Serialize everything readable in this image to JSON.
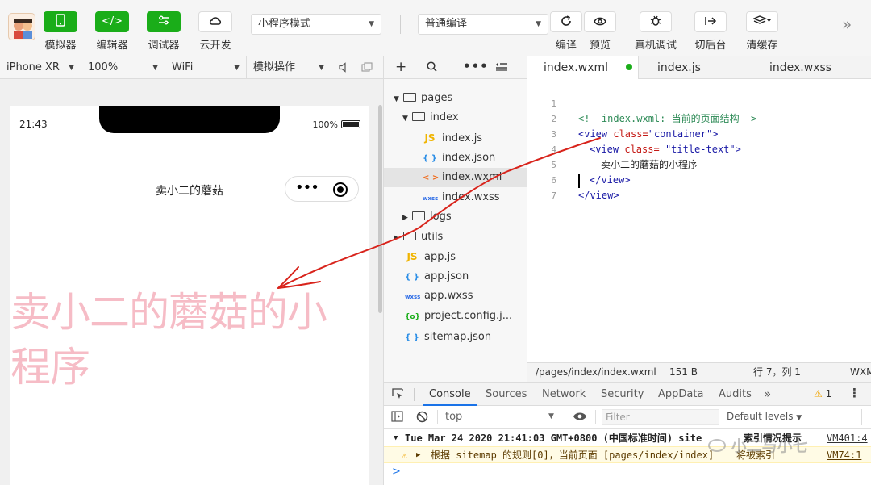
{
  "toolbar": {
    "buttons": [
      {
        "label": "模拟器",
        "icon": "phone-icon"
      },
      {
        "label": "编辑器",
        "icon": "code-icon"
      },
      {
        "label": "调试器",
        "icon": "sliders-icon"
      },
      {
        "label": "云开发",
        "icon": "cloud-icon"
      }
    ],
    "mode_select": "小程序模式",
    "compile_select": "普通编译",
    "actions": [
      {
        "label": "编译",
        "icon": "refresh-icon"
      },
      {
        "label": "预览",
        "icon": "eye-icon"
      },
      {
        "label": "真机调试",
        "icon": "bug-icon"
      },
      {
        "label": "切后台",
        "icon": "switch-icon"
      },
      {
        "label": "清缓存",
        "icon": "layers-icon"
      }
    ],
    "more": "»"
  },
  "devicebar": {
    "device": "iPhone XR",
    "zoom": "100%",
    "network": "WiFi",
    "operation": "模拟操作"
  },
  "phone": {
    "time": "21:43",
    "battery": "100%",
    "nav_title": "卖小二的蘑菇",
    "capsule_dots": "•••",
    "page_text": "卖小二的蘑菇的小程序"
  },
  "filetree": {
    "items": [
      {
        "label": "pages",
        "type": "folder",
        "expanded": true
      },
      {
        "label": "index",
        "type": "folder",
        "expanded": true
      },
      {
        "label": "index.js",
        "type": "js",
        "icon_text": "JS"
      },
      {
        "label": "index.json",
        "type": "json",
        "icon_text": "{ }"
      },
      {
        "label": "index.wxml",
        "type": "wxml",
        "icon_text": "< >"
      },
      {
        "label": "index.wxss",
        "type": "wxss",
        "icon_text": "wxss"
      },
      {
        "label": "logs",
        "type": "folder",
        "expanded": false
      },
      {
        "label": "utils",
        "type": "folder",
        "expanded": false
      },
      {
        "label": "app.js",
        "type": "js",
        "icon_text": "JS"
      },
      {
        "label": "app.json",
        "type": "json",
        "icon_text": "{ }"
      },
      {
        "label": "app.wxss",
        "type": "wxss",
        "icon_text": "wxss"
      },
      {
        "label": "project.config.j...",
        "type": "cfg",
        "icon_text": "{o}"
      },
      {
        "label": "sitemap.json",
        "type": "json",
        "icon_text": "{ }"
      }
    ]
  },
  "editor": {
    "tabs": [
      "index.wxml",
      "index.js",
      "index.wxss"
    ],
    "code": {
      "l1": "<!--index.wxml: 当前的页面结构-->",
      "l2_tag": "<view ",
      "l2_attr": "class=",
      "l2_val": "\"container\"",
      "l2_end": ">",
      "l3_tag": "<view ",
      "l3_attr": "class= ",
      "l3_val": "\"title-text\"",
      "l3_end": ">",
      "l4": "卖小二的蘑菇的小程序",
      "l5": "</view>",
      "l6": "</view>"
    },
    "line_numbers": [
      "1",
      "2",
      "3",
      "4",
      "5",
      "6",
      "7"
    ],
    "status": {
      "path": "/pages/index/index.wxml",
      "size": "151 B",
      "position": "行 7，列 1",
      "lang": "WXM"
    }
  },
  "devtools": {
    "tabs": [
      "Console",
      "Sources",
      "Network",
      "Security",
      "AppData",
      "Audits"
    ],
    "more": "»",
    "warn_count": "1",
    "context": "top",
    "filter_placeholder": "Filter",
    "levels": "Default levels",
    "log1_text": "Tue Mar 24 2020 21:41:03 GMT+0800 (中国标准时间) site",
    "log1_tail": "索引情况提示",
    "log1_src": "VM401:4",
    "log2_text": "根据 sitemap 的规则[0]，当前页面 [pages/index/index]",
    "log2_tail": "将被索引",
    "log2_src": "VM74:1",
    "prompt": ">"
  },
  "watermark": "小二与小七"
}
